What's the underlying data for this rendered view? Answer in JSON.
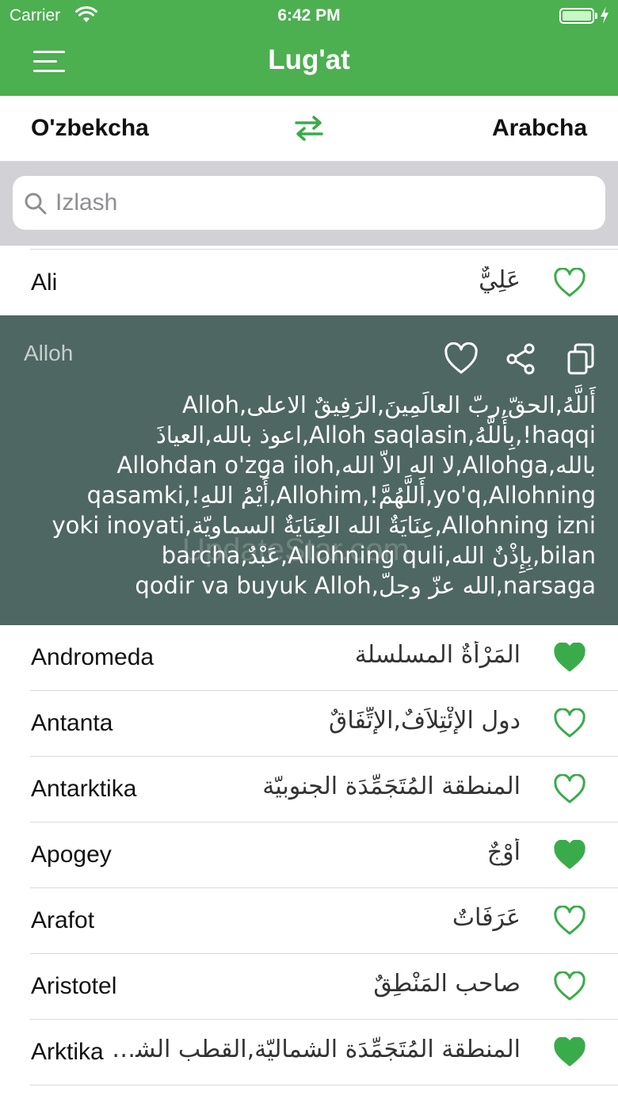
{
  "status_bar": {
    "carrier": "Carrier",
    "time": "6:42 PM"
  },
  "header": {
    "title": "Lug'at"
  },
  "languages": {
    "source": "O'zbekcha",
    "target": "Arabcha"
  },
  "search": {
    "placeholder": "Izlash"
  },
  "colors": {
    "accent": "#4caf50",
    "expanded_bg": "#4f6762",
    "heart": "#3aab4a"
  },
  "entries": [
    {
      "uz": "Ali",
      "ar": "عَلِيٌّ",
      "favorite": false
    }
  ],
  "expanded_entry": {
    "word": "Alloh",
    "translation": "أَللَّهُ,الحقّ,ربّ العالَمِينَ,الرَفِيقٌ الاعلى,Alloh haqqi!,بِأَللَّهُ,Alloh saqlasin,اعوذ بالله,العياذَ بالله,Allohga,لا اله الاّ الله,Allohdan o'zga iloh yo'q,Allohning,أَللَّهُمَّ!,Allohim,أَيْمُ اللهِ!,qasamki Allohning izni,عِنَايَةٌ الله العِنَايَةٌ السماويّة,yoki inoyati bilan,بِإِذْنٌ الله,Allohning quli,عَبْدٌ,barcha narsaga,الله عزّ وجلّ,qodir va buyuk Alloh",
    "watermark": "UpdateStar.com"
  },
  "entries_after": [
    {
      "uz": "Andromeda",
      "ar": "المَرْأَةٌ المسلسلة",
      "favorite": true
    },
    {
      "uz": "Antanta",
      "ar": "دول الإِئْتِلاَفٌ,الإِتِّفَاقٌ",
      "favorite": false
    },
    {
      "uz": "Antarktika",
      "ar": "المنطقة المُتَجَمِّدَة الجنوبيّة",
      "favorite": false
    },
    {
      "uz": "Apogey",
      "ar": "أَوْجٌ",
      "favorite": true
    },
    {
      "uz": "Arafot",
      "ar": "عَرَفَاتٌ",
      "favorite": false
    },
    {
      "uz": "Aristotel",
      "ar": "صاحب المَنْطِقٌ",
      "favorite": false
    },
    {
      "uz": "Arktika",
      "ar": "المنطقة المُتَجَمِّدَة الشماليّة,القطب الشمالي",
      "favorite": true
    }
  ]
}
